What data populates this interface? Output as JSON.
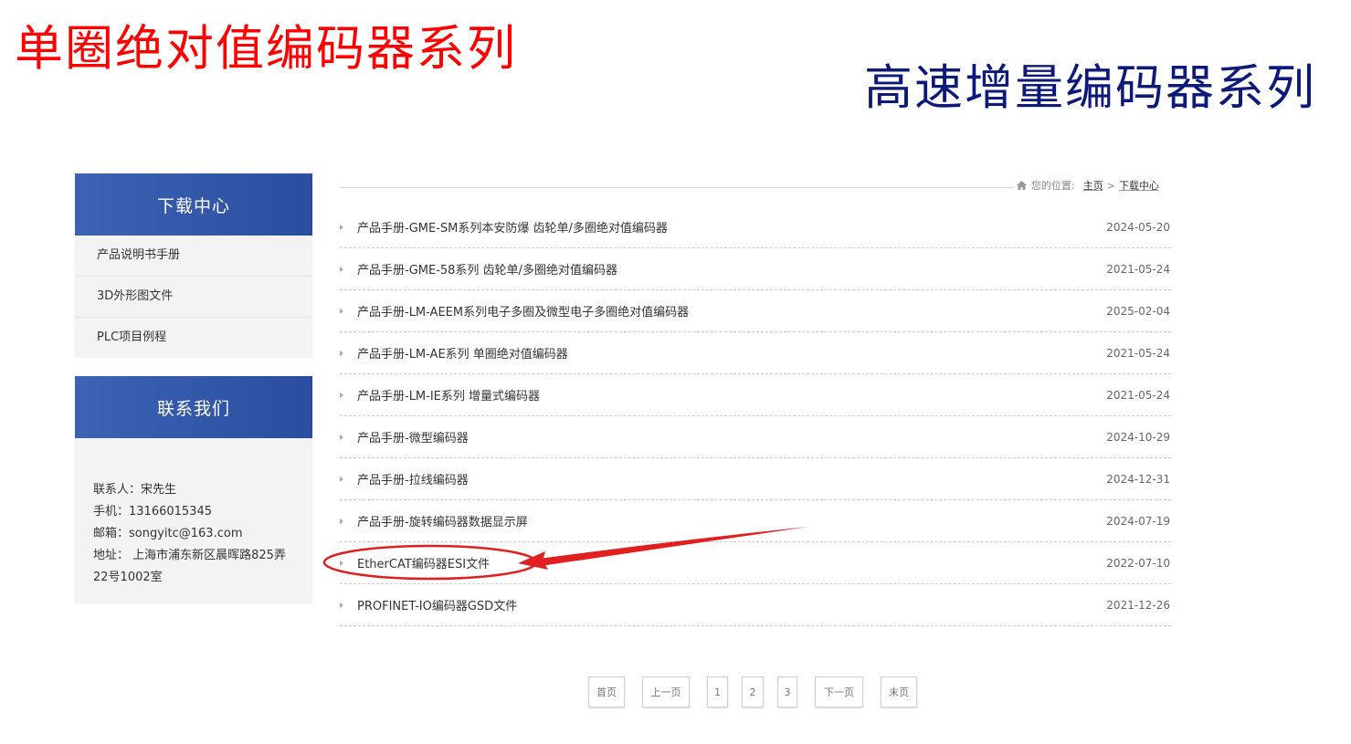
{
  "headlines": {
    "left": "单圈绝对值编码器系列",
    "right": "高速增量编码器系列"
  },
  "colors": {
    "headline_left": "#ff0000",
    "headline_right": "#0d1a7a",
    "sidebar_header": "#2f55a8",
    "annotation": "#e02020"
  },
  "sidebar": {
    "download_title": "下载中心",
    "items": [
      {
        "label": "产品说明书手册"
      },
      {
        "label": "3D外形图文件"
      },
      {
        "label": "PLC项目例程"
      }
    ],
    "contact_title": "联系我们",
    "contact": {
      "person": "联系人：宋先生",
      "phone": "手机：13166015345",
      "email": "邮箱：songyitc@163.com",
      "address": "地址： 上海市浦东新区晨晖路825弄22号1002室"
    }
  },
  "breadcrumb": {
    "icon": "home-icon",
    "prefix": "您的位置:",
    "home": "主页",
    "separator": ">",
    "current": "下载中心"
  },
  "files": [
    {
      "title": "产品手册-GME-SM系列本安防爆 齿轮单/多圈绝对值编码器",
      "date": "2024-05-20"
    },
    {
      "title": "产品手册-GME-58系列 齿轮单/多圈绝对值编码器",
      "date": "2021-05-24"
    },
    {
      "title": "产品手册-LM-AEEM系列电子多圈及微型电子多圈绝对值编码器",
      "date": "2025-02-04"
    },
    {
      "title": "产品手册-LM-AE系列 单圈绝对值编码器",
      "date": "2021-05-24"
    },
    {
      "title": "产品手册-LM-IE系列 增量式编码器",
      "date": "2021-05-24"
    },
    {
      "title": "产品手册-微型编码器",
      "date": "2024-10-29"
    },
    {
      "title": "产品手册-拉线编码器",
      "date": "2024-12-31"
    },
    {
      "title": "产品手册-旋转编码器数据显示屏",
      "date": "2024-07-19"
    },
    {
      "title": "EtherCAT编码器ESI文件",
      "date": "2022-07-10"
    },
    {
      "title": "PROFINET-IO编码器GSD文件",
      "date": "2021-12-26"
    }
  ],
  "pagination": {
    "first": "首页",
    "prev": "上一页",
    "pages": [
      "1",
      "2",
      "3"
    ],
    "next": "下一页",
    "last": "末页"
  }
}
